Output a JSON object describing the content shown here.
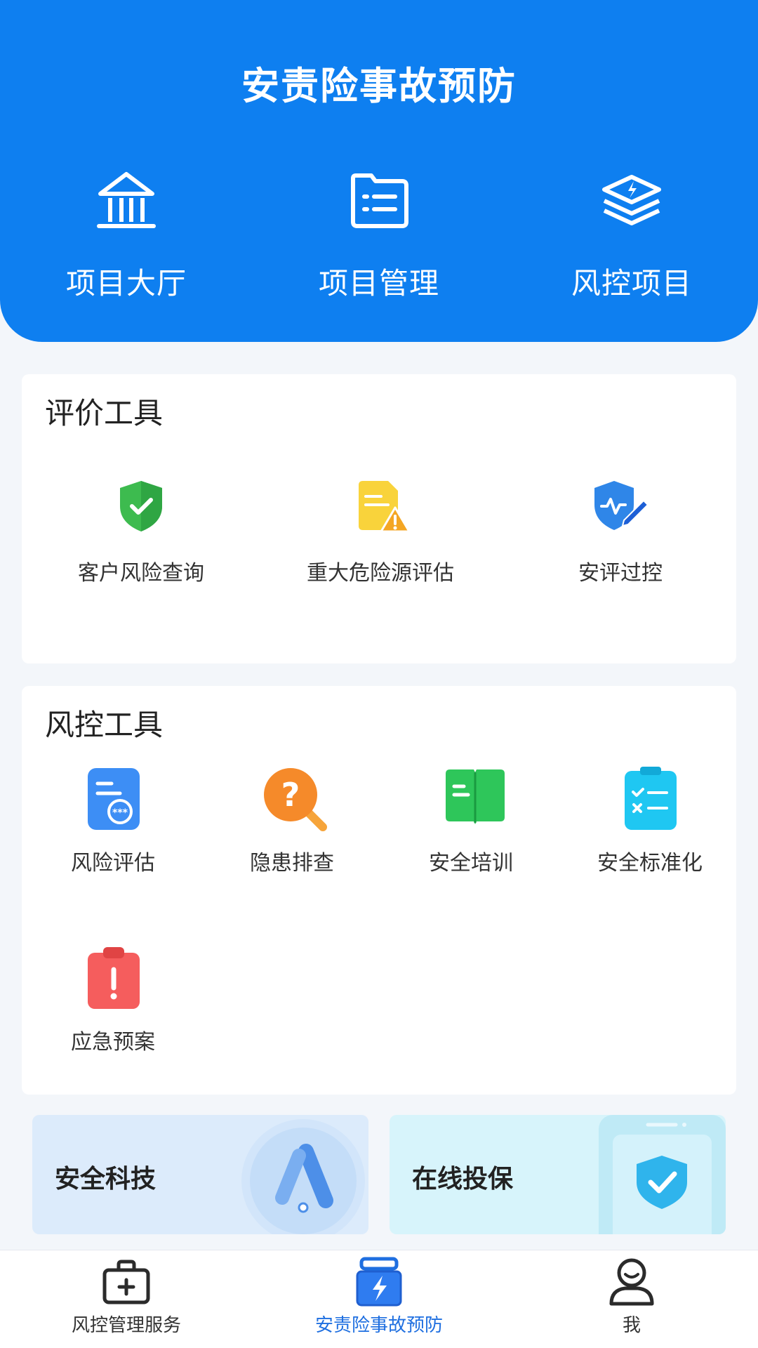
{
  "header": {
    "title": "安责险事故预防",
    "nav": [
      {
        "label": "项目大厅",
        "icon": "building-icon"
      },
      {
        "label": "项目管理",
        "icon": "folder-list-icon"
      },
      {
        "label": "风控项目",
        "icon": "layers-icon"
      }
    ]
  },
  "evaluation": {
    "title": "评价工具",
    "items": [
      {
        "label": "客户风险查询",
        "icon": "shield-check-icon"
      },
      {
        "label": "重大危险源评估",
        "icon": "document-warning-icon"
      },
      {
        "label": "安评过控",
        "icon": "shield-edit-icon"
      }
    ]
  },
  "risk_tools": {
    "title": "风控工具",
    "items": [
      {
        "label": "风险评估",
        "icon": "assessment-doc-icon"
      },
      {
        "label": "隐患排查",
        "icon": "question-search-icon"
      },
      {
        "label": "安全培训",
        "icon": "open-book-icon"
      },
      {
        "label": "安全标准化",
        "icon": "checklist-clipboard-icon"
      },
      {
        "label": "应急预案",
        "icon": "emergency-clipboard-icon"
      }
    ]
  },
  "promos": [
    {
      "label": "安全科技",
      "icon": "tech-logo-icon"
    },
    {
      "label": "在线投保",
      "icon": "phone-shield-icon"
    }
  ],
  "tabbar": {
    "items": [
      {
        "label": "风控管理服务",
        "icon": "medical-kit-icon",
        "active": false
      },
      {
        "label": "安责险事故预防",
        "icon": "lightning-box-icon",
        "active": true
      },
      {
        "label": "我",
        "icon": "user-icon",
        "active": false
      }
    ],
    "active_color": "#1f6fe0"
  },
  "colors": {
    "brand": "#0e7ff0",
    "background": "#f3f6fa"
  }
}
